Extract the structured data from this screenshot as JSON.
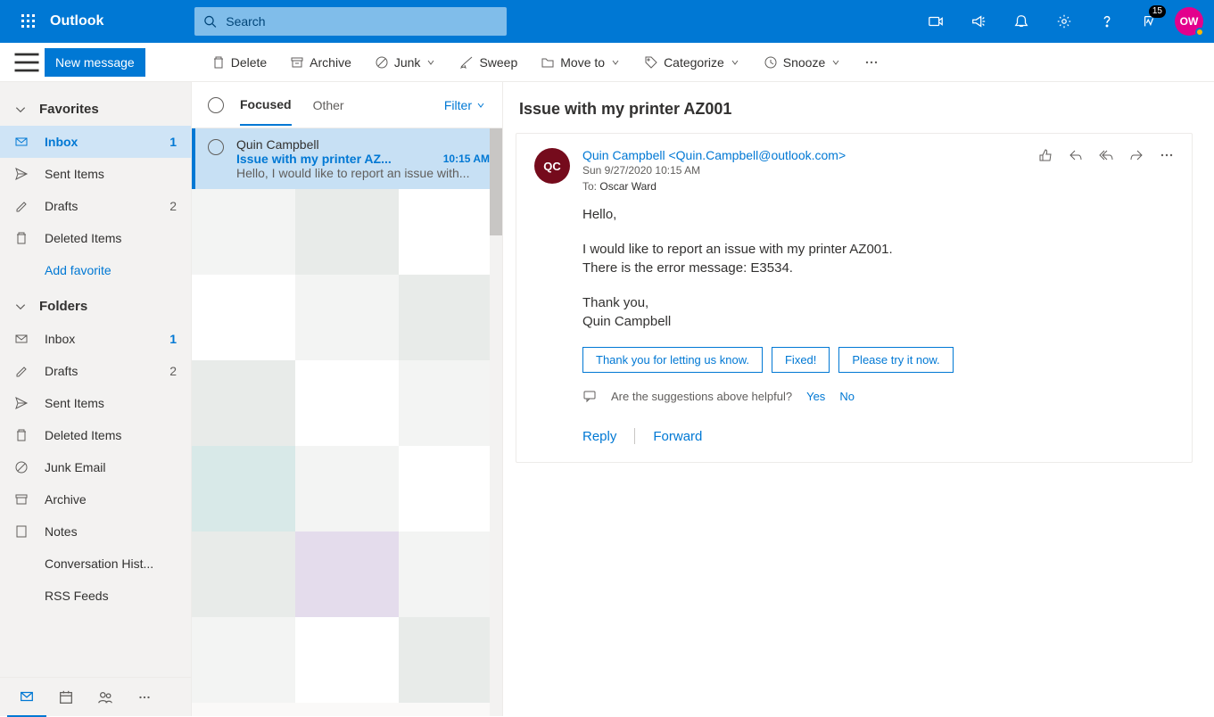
{
  "header": {
    "brand": "Outlook",
    "search_placeholder": "Search",
    "notification_count": "15",
    "avatar_initials": "OW"
  },
  "toolbar": {
    "new_message": "New message",
    "delete": "Delete",
    "archive": "Archive",
    "junk": "Junk",
    "sweep": "Sweep",
    "move_to": "Move to",
    "categorize": "Categorize",
    "snooze": "Snooze"
  },
  "sidebar": {
    "favorites_label": "Favorites",
    "folders_label": "Folders",
    "favorites": [
      {
        "icon": "inbox",
        "label": "Inbox",
        "count": "1",
        "active": true
      },
      {
        "icon": "sent",
        "label": "Sent Items"
      },
      {
        "icon": "drafts",
        "label": "Drafts",
        "count": "2",
        "muted": true
      },
      {
        "icon": "deleted",
        "label": "Deleted Items"
      }
    ],
    "add_favorite": "Add favorite",
    "folders": [
      {
        "icon": "inbox",
        "label": "Inbox",
        "count": "1"
      },
      {
        "icon": "drafts",
        "label": "Drafts",
        "count": "2",
        "muted": true
      },
      {
        "icon": "sent",
        "label": "Sent Items"
      },
      {
        "icon": "deleted",
        "label": "Deleted Items"
      },
      {
        "icon": "junk",
        "label": "Junk Email"
      },
      {
        "icon": "archive",
        "label": "Archive"
      },
      {
        "icon": "notes",
        "label": "Notes"
      },
      {
        "icon": "",
        "label": "Conversation Hist..."
      },
      {
        "icon": "",
        "label": "RSS Feeds"
      }
    ]
  },
  "msglist": {
    "tab_focused": "Focused",
    "tab_other": "Other",
    "filter": "Filter",
    "items": [
      {
        "from": "Quin Campbell",
        "subject": "Issue with my printer AZ...",
        "time": "10:15 AM",
        "preview": "Hello, I would like to report an issue with..."
      }
    ]
  },
  "reading": {
    "subject": "Issue with my printer AZ001",
    "avatar_initials": "QC",
    "sender": "Quin Campbell <Quin.Campbell@outlook.com>",
    "date": "Sun 9/27/2020 10:15 AM",
    "to_label": "To:",
    "to_value": "Oscar Ward",
    "body_p1": "Hello,",
    "body_p2a": "I would like to report an issue with my printer AZ001.",
    "body_p2b": "There is the error message: E3534.",
    "body_p3a": "Thank you,",
    "body_p3b": "Quin Campbell",
    "suggestions": [
      "Thank you for letting us know.",
      "Fixed!",
      "Please try it now."
    ],
    "feedback_q": "Are the suggestions above helpful?",
    "feedback_yes": "Yes",
    "feedback_no": "No",
    "reply": "Reply",
    "forward": "Forward"
  }
}
